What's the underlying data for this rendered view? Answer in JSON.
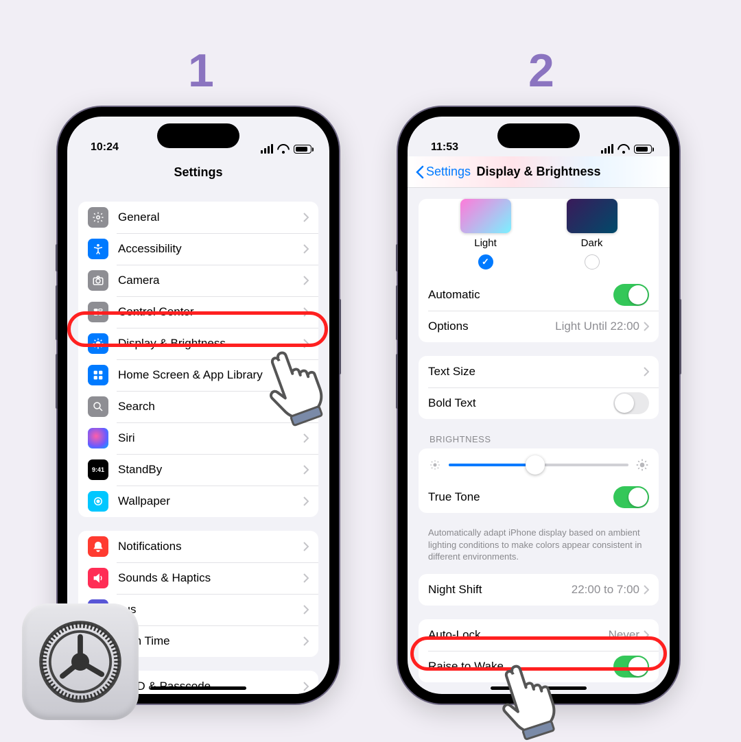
{
  "step_labels": {
    "one": "1",
    "two": "2"
  },
  "phone1": {
    "time": "10:24",
    "title": "Settings",
    "rows": [
      {
        "label": "General"
      },
      {
        "label": "Accessibility"
      },
      {
        "label": "Camera"
      },
      {
        "label": "Control Center"
      },
      {
        "label": "Display & Brightness"
      },
      {
        "label": "Home Screen & App Library"
      },
      {
        "label": "Search"
      },
      {
        "label": "Siri"
      },
      {
        "label": "StandBy"
      },
      {
        "label": "Wallpaper"
      }
    ],
    "rows2": [
      {
        "label": "Notifications"
      },
      {
        "label": "Sounds & Haptics"
      },
      {
        "label_partial": "cus"
      },
      {
        "label_partial": "reen Time"
      }
    ],
    "rows3_partial": "ce ID & Passcode"
  },
  "phone2": {
    "time": "11:53",
    "back": "Settings",
    "title": "Display & Brightness",
    "appearance": {
      "light": "Light",
      "dark": "Dark"
    },
    "automatic": {
      "label": "Automatic",
      "on": true
    },
    "options": {
      "label": "Options",
      "value": "Light Until 22:00"
    },
    "text_size": "Text Size",
    "bold_text": {
      "label": "Bold Text",
      "on": false
    },
    "brightness_header": "BRIGHTNESS",
    "true_tone": {
      "label": "True Tone",
      "on": true
    },
    "true_tone_note": "Automatically adapt iPhone display based on ambient lighting conditions to make colors appear consistent in different environments.",
    "night_shift": {
      "label": "Night Shift",
      "value": "22:00 to 7:00"
    },
    "auto_lock": {
      "label": "Auto-Lock",
      "value": "Never"
    },
    "raise_wake": {
      "label": "Raise to Wake",
      "on": true
    }
  }
}
